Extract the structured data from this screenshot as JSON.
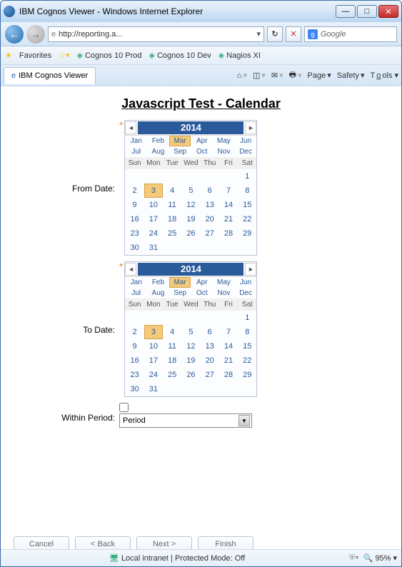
{
  "window_title": "IBM Cognos Viewer - Windows Internet Explorer",
  "address_url": "http://reporting.a...",
  "search_placeholder": "Google",
  "favorites_label": "Favorites",
  "fav_items": [
    "Cognos 10 Prod",
    "Cognos 10 Dev",
    "Nagios XI"
  ],
  "tab_title": "IBM Cognos Viewer",
  "cmd": {
    "page": "Page",
    "safety": "Safety",
    "tools": "Tools"
  },
  "heading": "Javascript Test - Calendar",
  "labels": {
    "from": "From Date:",
    "to": "To Date:",
    "within": "Within Period:"
  },
  "period_value": "Period",
  "calendar": {
    "year": "2014",
    "months_row1": [
      "Jan",
      "Feb",
      "Mar",
      "Apr",
      "May",
      "Jun"
    ],
    "months_row2": [
      "Jul",
      "Aug",
      "Sep",
      "Oct",
      "Nov",
      "Dec"
    ],
    "dow": [
      "Sun",
      "Mon",
      "Tue",
      "Wed",
      "Thu",
      "Fri",
      "Sat"
    ],
    "selected_month_index": 2,
    "selected_day": 3,
    "first_dow": 6,
    "num_days": 31
  },
  "buttons": {
    "cancel": "Cancel",
    "back": "< Back",
    "next": "Next >",
    "finish": "Finish"
  },
  "status": {
    "zone": "Local intranet | Protected Mode: Off",
    "zoom": "95%"
  }
}
